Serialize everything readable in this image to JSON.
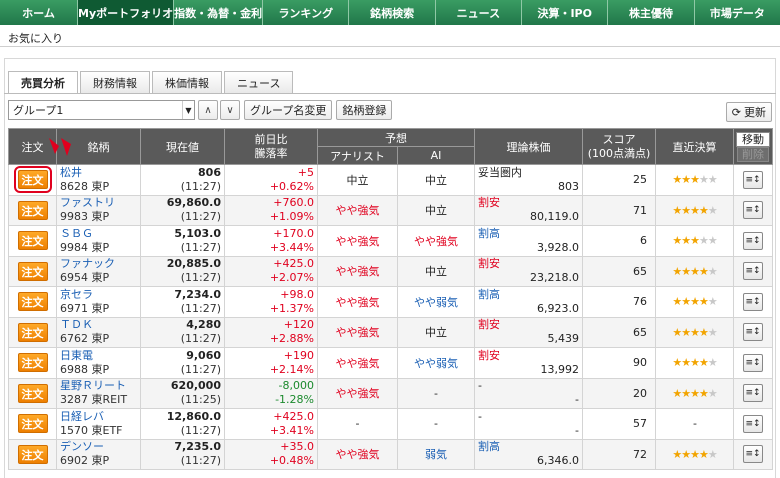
{
  "nav": [
    "ホーム",
    "Myポートフォリオ",
    "指数・為替・金利",
    "ランキング",
    "銘柄検索",
    "ニュース",
    "決算・IPO",
    "株主優待",
    "市場データ"
  ],
  "subtab": "お気に入り",
  "tabs": [
    "売買分析",
    "財務情報",
    "株価情報",
    "ニュース"
  ],
  "toolbar": {
    "group": "グループ1",
    "rename": "グループ名変更",
    "register": "銘柄登録",
    "refresh": "更新"
  },
  "headers": {
    "order": "注文",
    "name": "銘柄",
    "price": "現在値",
    "change_l1": "前日比",
    "change_l2": "騰落率",
    "forecast": "予想",
    "analyst": "アナリスト",
    "ai": "AI",
    "theory": "理論株価",
    "score_l1": "スコア",
    "score_l2": "(100点満点)",
    "earnings": "直近決算",
    "move": "移動",
    "delete": "削除"
  },
  "order_label": "注文",
  "colors": {
    "nav": "#2e8b57",
    "order_btn": "#f29000",
    "up": "#e0001e",
    "down": "#1c8a2e",
    "link": "#1a5fb4"
  },
  "rows": [
    {
      "name": "松井",
      "code": "8628 東P",
      "price": "806",
      "time": "(11:27)",
      "chg": "+5",
      "pct": "+0.62%",
      "dir": "up",
      "analyst": "中立",
      "analyst_c": "",
      "ai": "中立",
      "ai_c": "",
      "theory_label": "妥当圏内",
      "theory_c": "",
      "theory": "803",
      "score": "25",
      "stars": 3
    },
    {
      "name": "ファストリ",
      "code": "9983 東P",
      "price": "69,860.0",
      "time": "(11:27)",
      "chg": "+760.0",
      "pct": "+1.09%",
      "dir": "up",
      "analyst": "やや強気",
      "analyst_c": "red",
      "ai": "中立",
      "ai_c": "",
      "theory_label": "割安",
      "theory_c": "red",
      "theory": "80,119.0",
      "score": "71",
      "stars": 4
    },
    {
      "name": "ＳＢＧ",
      "code": "9984 東P",
      "price": "5,103.0",
      "time": "(11:27)",
      "chg": "+170.0",
      "pct": "+3.44%",
      "dir": "up",
      "analyst": "やや強気",
      "analyst_c": "red",
      "ai": "やや強気",
      "ai_c": "red",
      "theory_label": "割高",
      "theory_c": "blue",
      "theory": "3,928.0",
      "score": "6",
      "stars": 3
    },
    {
      "name": "ファナック",
      "code": "6954 東P",
      "price": "20,885.0",
      "time": "(11:27)",
      "chg": "+425.0",
      "pct": "+2.07%",
      "dir": "up",
      "analyst": "やや強気",
      "analyst_c": "red",
      "ai": "中立",
      "ai_c": "",
      "theory_label": "割安",
      "theory_c": "red",
      "theory": "23,218.0",
      "score": "65",
      "stars": 4
    },
    {
      "name": "京セラ",
      "code": "6971 東P",
      "price": "7,234.0",
      "time": "(11:27)",
      "chg": "+98.0",
      "pct": "+1.37%",
      "dir": "up",
      "analyst": "やや強気",
      "analyst_c": "red",
      "ai": "やや弱気",
      "ai_c": "blue",
      "theory_label": "割高",
      "theory_c": "blue",
      "theory": "6,923.0",
      "score": "76",
      "stars": 4
    },
    {
      "name": "ＴＤＫ",
      "code": "6762 東P",
      "price": "4,280",
      "time": "(11:27)",
      "chg": "+120",
      "pct": "+2.88%",
      "dir": "up",
      "analyst": "やや強気",
      "analyst_c": "red",
      "ai": "中立",
      "ai_c": "",
      "theory_label": "割安",
      "theory_c": "red",
      "theory": "5,439",
      "score": "65",
      "stars": 4
    },
    {
      "name": "日東電",
      "code": "6988 東P",
      "price": "9,060",
      "time": "(11:27)",
      "chg": "+190",
      "pct": "+2.14%",
      "dir": "up",
      "analyst": "やや強気",
      "analyst_c": "red",
      "ai": "やや弱気",
      "ai_c": "blue",
      "theory_label": "割安",
      "theory_c": "red",
      "theory": "13,992",
      "score": "90",
      "stars": 4
    },
    {
      "name": "星野Ｒリート",
      "code": "3287 東REIT",
      "price": "620,000",
      "time": "(11:25)",
      "chg": "-8,000",
      "pct": "-1.28%",
      "dir": "down",
      "analyst": "やや強気",
      "analyst_c": "red",
      "ai": "-",
      "ai_c": "",
      "theory_label": "-",
      "theory_c": "",
      "theory": "-",
      "score": "20",
      "stars": 4
    },
    {
      "name": "日経レバ",
      "code": "1570 東ETF",
      "price": "12,860.0",
      "time": "(11:27)",
      "chg": "+425.0",
      "pct": "+3.41%",
      "dir": "up",
      "analyst": "-",
      "analyst_c": "",
      "ai": "-",
      "ai_c": "",
      "theory_label": "-",
      "theory_c": "",
      "theory": "-",
      "score": "57",
      "stars": 0
    },
    {
      "name": "デンソー",
      "code": "6902 東P",
      "price": "7,235.0",
      "time": "(11:27)",
      "chg": "+35.0",
      "pct": "+0.48%",
      "dir": "up",
      "analyst": "やや強気",
      "analyst_c": "red",
      "ai": "弱気",
      "ai_c": "blue",
      "theory_label": "割高",
      "theory_c": "blue",
      "theory": "6,346.0",
      "score": "72",
      "stars": 4
    }
  ]
}
